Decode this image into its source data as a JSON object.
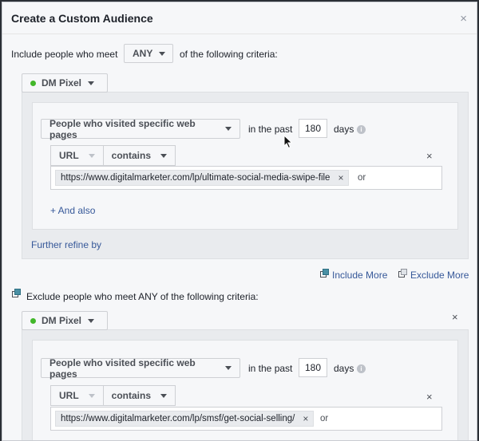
{
  "dialog": {
    "title": "Create a Custom Audience",
    "close_icon": "×"
  },
  "include": {
    "prefix": "Include people who meet",
    "match": "ANY",
    "suffix": "of the following criteria:",
    "pixel": {
      "label": "DM Pixel",
      "status_color": "#42b72a"
    },
    "rule": {
      "type": "People who visited specific web pages",
      "in_the_past": "in the past",
      "days_value": "180",
      "days_label": "days",
      "info_icon": "i",
      "field": "URL",
      "operator": "contains",
      "url": "https://www.digitalmarketer.com/lp/ultimate-social-media-swipe-file",
      "or": "or",
      "and_also": "+ And also"
    },
    "further_refine": "Further refine by"
  },
  "actions": {
    "include_more": "Include More",
    "exclude_more": "Exclude More"
  },
  "exclude": {
    "label": "Exclude people who meet ANY of the following criteria:",
    "pixel": {
      "label": "DM Pixel",
      "status_color": "#42b72a"
    },
    "rule": {
      "type": "People who visited specific web pages",
      "in_the_past": "in the past",
      "days_value": "180",
      "days_label": "days",
      "info_icon": "i",
      "field": "URL",
      "operator": "contains",
      "url": "https://www.digitalmarketer.com/lp/smsf/get-social-selling/",
      "or": "or"
    }
  },
  "icons": {
    "remove": "×"
  }
}
